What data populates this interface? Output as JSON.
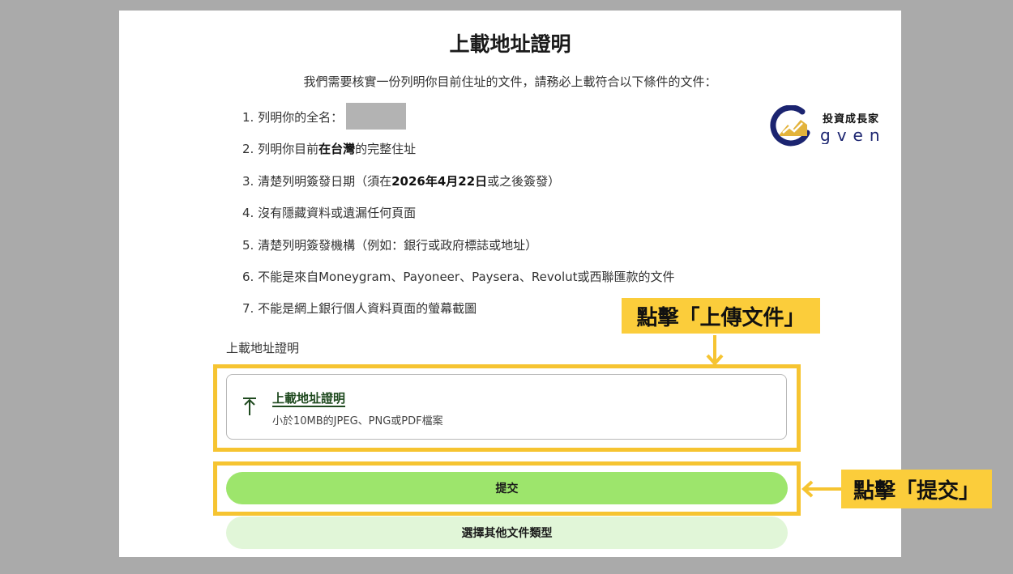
{
  "page": {
    "title": "上載地址證明",
    "intro": "我們需要核實一份列明你目前住址的文件，請務必上載符合以下條件的文件："
  },
  "requirements": [
    {
      "num": "1.",
      "pre": "列明你的全名：",
      "bold": "",
      "post": ""
    },
    {
      "num": "2.",
      "pre": "列明你目前",
      "bold": "在台灣",
      "post": "的完整住址"
    },
    {
      "num": "3.",
      "pre": "清楚列明簽發日期（須在",
      "bold": "2026年4月22日",
      "post": "或之後簽發）"
    },
    {
      "num": "4.",
      "pre": "沒有隱藏資料或遺漏任何頁面",
      "bold": "",
      "post": ""
    },
    {
      "num": "5.",
      "pre": "清楚列明簽發機構（例如：銀行或政府標誌或地址）",
      "bold": "",
      "post": ""
    },
    {
      "num": "6.",
      "pre": "不能是來自Moneygram、Payoneer、Paysera、Revolut或西聯匯款的文件",
      "bold": "",
      "post": ""
    },
    {
      "num": "7.",
      "pre": "不能是網上銀行個人資料頁面的螢幕截圖",
      "bold": "",
      "post": ""
    }
  ],
  "logo": {
    "cn_text": "投資成長家",
    "en_text": "GVEN"
  },
  "upload": {
    "field_label": "上載地址證明",
    "title": "上載地址證明",
    "hint": "小於10MB的JPEG、PNG或PDF檔案",
    "icon": "upload-arrow-icon"
  },
  "buttons": {
    "submit": "提交",
    "other_type": "選擇其他文件類型"
  },
  "annotations": {
    "upload_callout": "點擊「上傳文件」",
    "submit_callout": "點擊「提交」"
  },
  "colors": {
    "highlight": "#f6c431",
    "submit_bg": "#9de56c",
    "other_bg": "#e1f6d8",
    "logo_blue": "#1b2470",
    "logo_gold": "#e3b33c"
  }
}
